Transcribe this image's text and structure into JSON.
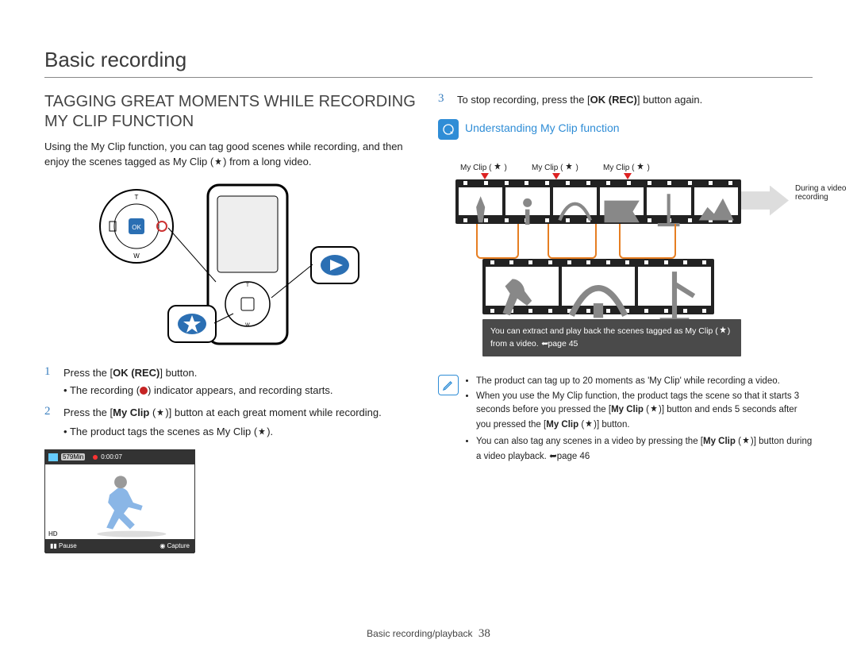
{
  "page_title": "Basic recording",
  "section_heading": "TAGGING GREAT MOMENTS WHILE RECORDING MY CLIP FUNCTION",
  "intro": "Using the My Clip function, you can tag good scenes while recording, and then enjoy the scenes tagged as My Clip (",
  "intro_tail": ") from a long video.",
  "steps": [
    {
      "num": "1",
      "main_a": "Press the [",
      "main_b": "OK (REC)",
      "main_c": "] button.",
      "sub_a": "The recording (",
      "sub_b": ") indicator appears, and recording starts."
    },
    {
      "num": "2",
      "main_a": "Press the [",
      "main_b": "My Clip",
      "main_c": " (",
      "main_d": ")] button at each great moment while recording.",
      "sub_a": "The product tags the scenes as My Clip (",
      "sub_b": ")."
    },
    {
      "num": "3",
      "main_a": "To stop recording, press the [",
      "main_b": "OK (REC)",
      "main_c": "] button again."
    }
  ],
  "screenshot": {
    "remaining": "579Min",
    "timer": "0:00:07",
    "hd": "HD",
    "pause": "Pause",
    "capture": "Capture"
  },
  "info": {
    "title": "Understanding My Clip function",
    "tag_label": "My Clip (",
    "tag_label_tail": ")",
    "during": "During a video recording",
    "caption_a": "You can extract and play back the scenes tagged as My Clip (",
    "caption_b": ") from a video. ",
    "caption_c": "page 45"
  },
  "notes": [
    "The product can tag up to 20 moments as 'My Clip' while recording a video.",
    {
      "a": "When you use the My Clip function, the product tags the scene so that it starts 3 seconds before you pressed the [",
      "b": "My Clip",
      "c": " (",
      "d": ")] button and ends 5 seconds after you pressed the [",
      "e": "My Clip",
      "f": " (",
      "g": ")] button."
    },
    {
      "a": "You can also tag any scenes in a video by pressing the [",
      "b": "My Clip",
      "c": " (",
      "d": ")] button during a video playback. ",
      "e": "page 46"
    }
  ],
  "footer": {
    "section": "Basic recording/playback",
    "page": "38"
  }
}
